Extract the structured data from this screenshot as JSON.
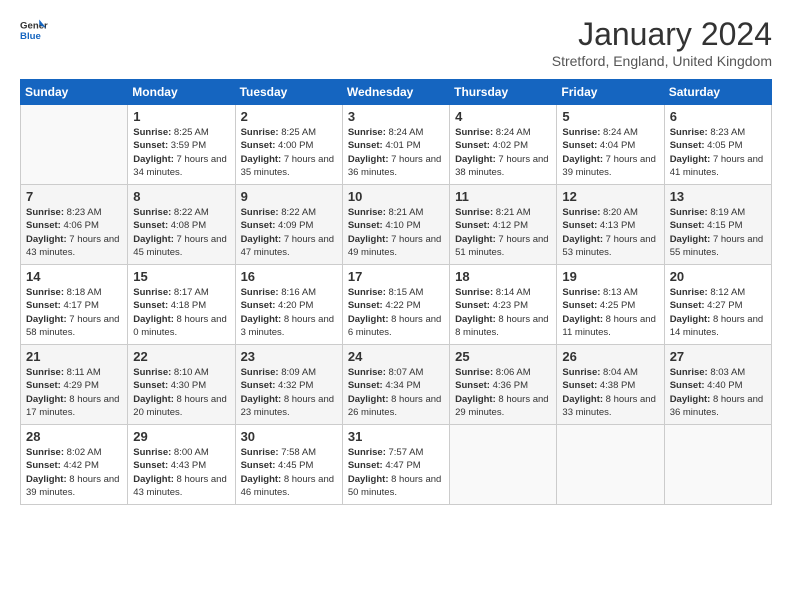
{
  "logo": {
    "text_general": "General",
    "text_blue": "Blue"
  },
  "header": {
    "title": "January 2024",
    "location": "Stretford, England, United Kingdom"
  },
  "columns": [
    "Sunday",
    "Monday",
    "Tuesday",
    "Wednesday",
    "Thursday",
    "Friday",
    "Saturday"
  ],
  "weeks": [
    [
      {
        "day": "",
        "sunrise": "",
        "sunset": "",
        "daylight": ""
      },
      {
        "day": "1",
        "sunrise": "8:25 AM",
        "sunset": "3:59 PM",
        "daylight": "7 hours and 34 minutes."
      },
      {
        "day": "2",
        "sunrise": "8:25 AM",
        "sunset": "4:00 PM",
        "daylight": "7 hours and 35 minutes."
      },
      {
        "day": "3",
        "sunrise": "8:24 AM",
        "sunset": "4:01 PM",
        "daylight": "7 hours and 36 minutes."
      },
      {
        "day": "4",
        "sunrise": "8:24 AM",
        "sunset": "4:02 PM",
        "daylight": "7 hours and 38 minutes."
      },
      {
        "day": "5",
        "sunrise": "8:24 AM",
        "sunset": "4:04 PM",
        "daylight": "7 hours and 39 minutes."
      },
      {
        "day": "6",
        "sunrise": "8:23 AM",
        "sunset": "4:05 PM",
        "daylight": "7 hours and 41 minutes."
      }
    ],
    [
      {
        "day": "7",
        "sunrise": "8:23 AM",
        "sunset": "4:06 PM",
        "daylight": "7 hours and 43 minutes."
      },
      {
        "day": "8",
        "sunrise": "8:22 AM",
        "sunset": "4:08 PM",
        "daylight": "7 hours and 45 minutes."
      },
      {
        "day": "9",
        "sunrise": "8:22 AM",
        "sunset": "4:09 PM",
        "daylight": "7 hours and 47 minutes."
      },
      {
        "day": "10",
        "sunrise": "8:21 AM",
        "sunset": "4:10 PM",
        "daylight": "7 hours and 49 minutes."
      },
      {
        "day": "11",
        "sunrise": "8:21 AM",
        "sunset": "4:12 PM",
        "daylight": "7 hours and 51 minutes."
      },
      {
        "day": "12",
        "sunrise": "8:20 AM",
        "sunset": "4:13 PM",
        "daylight": "7 hours and 53 minutes."
      },
      {
        "day": "13",
        "sunrise": "8:19 AM",
        "sunset": "4:15 PM",
        "daylight": "7 hours and 55 minutes."
      }
    ],
    [
      {
        "day": "14",
        "sunrise": "8:18 AM",
        "sunset": "4:17 PM",
        "daylight": "7 hours and 58 minutes."
      },
      {
        "day": "15",
        "sunrise": "8:17 AM",
        "sunset": "4:18 PM",
        "daylight": "8 hours and 0 minutes."
      },
      {
        "day": "16",
        "sunrise": "8:16 AM",
        "sunset": "4:20 PM",
        "daylight": "8 hours and 3 minutes."
      },
      {
        "day": "17",
        "sunrise": "8:15 AM",
        "sunset": "4:22 PM",
        "daylight": "8 hours and 6 minutes."
      },
      {
        "day": "18",
        "sunrise": "8:14 AM",
        "sunset": "4:23 PM",
        "daylight": "8 hours and 8 minutes."
      },
      {
        "day": "19",
        "sunrise": "8:13 AM",
        "sunset": "4:25 PM",
        "daylight": "8 hours and 11 minutes."
      },
      {
        "day": "20",
        "sunrise": "8:12 AM",
        "sunset": "4:27 PM",
        "daylight": "8 hours and 14 minutes."
      }
    ],
    [
      {
        "day": "21",
        "sunrise": "8:11 AM",
        "sunset": "4:29 PM",
        "daylight": "8 hours and 17 minutes."
      },
      {
        "day": "22",
        "sunrise": "8:10 AM",
        "sunset": "4:30 PM",
        "daylight": "8 hours and 20 minutes."
      },
      {
        "day": "23",
        "sunrise": "8:09 AM",
        "sunset": "4:32 PM",
        "daylight": "8 hours and 23 minutes."
      },
      {
        "day": "24",
        "sunrise": "8:07 AM",
        "sunset": "4:34 PM",
        "daylight": "8 hours and 26 minutes."
      },
      {
        "day": "25",
        "sunrise": "8:06 AM",
        "sunset": "4:36 PM",
        "daylight": "8 hours and 29 minutes."
      },
      {
        "day": "26",
        "sunrise": "8:04 AM",
        "sunset": "4:38 PM",
        "daylight": "8 hours and 33 minutes."
      },
      {
        "day": "27",
        "sunrise": "8:03 AM",
        "sunset": "4:40 PM",
        "daylight": "8 hours and 36 minutes."
      }
    ],
    [
      {
        "day": "28",
        "sunrise": "8:02 AM",
        "sunset": "4:42 PM",
        "daylight": "8 hours and 39 minutes."
      },
      {
        "day": "29",
        "sunrise": "8:00 AM",
        "sunset": "4:43 PM",
        "daylight": "8 hours and 43 minutes."
      },
      {
        "day": "30",
        "sunrise": "7:58 AM",
        "sunset": "4:45 PM",
        "daylight": "8 hours and 46 minutes."
      },
      {
        "day": "31",
        "sunrise": "7:57 AM",
        "sunset": "4:47 PM",
        "daylight": "8 hours and 50 minutes."
      },
      {
        "day": "",
        "sunrise": "",
        "sunset": "",
        "daylight": ""
      },
      {
        "day": "",
        "sunrise": "",
        "sunset": "",
        "daylight": ""
      },
      {
        "day": "",
        "sunrise": "",
        "sunset": "",
        "daylight": ""
      }
    ]
  ],
  "labels": {
    "sunrise": "Sunrise:",
    "sunset": "Sunset:",
    "daylight": "Daylight:"
  }
}
